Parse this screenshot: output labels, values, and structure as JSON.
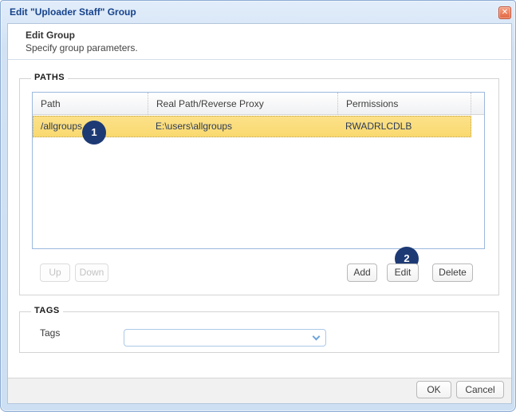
{
  "dialog": {
    "title": "Edit \"Uploader Staff\" Group",
    "close_glyph": "✕"
  },
  "header": {
    "title": "Edit Group",
    "subtitle": "Specify group parameters."
  },
  "paths_section": {
    "legend": "PATHS",
    "table": {
      "columns": [
        "Path",
        "Real Path/Reverse Proxy",
        "Permissions"
      ],
      "rows": [
        {
          "path": "/allgroups",
          "real_path": "E:\\users\\allgroups",
          "permissions": "RWADRLCDLB",
          "selected": true
        }
      ]
    },
    "buttons": {
      "up": "Up",
      "down": "Down",
      "add": "Add",
      "edit": "Edit",
      "delete": "Delete"
    }
  },
  "annotations": {
    "step1": "1",
    "step2": "2"
  },
  "tags_section": {
    "legend": "TAGS",
    "label": "Tags",
    "combobox_value": ""
  },
  "footer": {
    "ok": "OK",
    "cancel": "Cancel"
  },
  "colors": {
    "title_text": "#15428b",
    "selected_row": "#fadc7a",
    "badge": "#1d3a74",
    "close_button": "#e2653f",
    "grid_border": "#9cb9dd",
    "combobox_border": "#abc9e8",
    "dialog_frame": "#d2e2f4"
  }
}
